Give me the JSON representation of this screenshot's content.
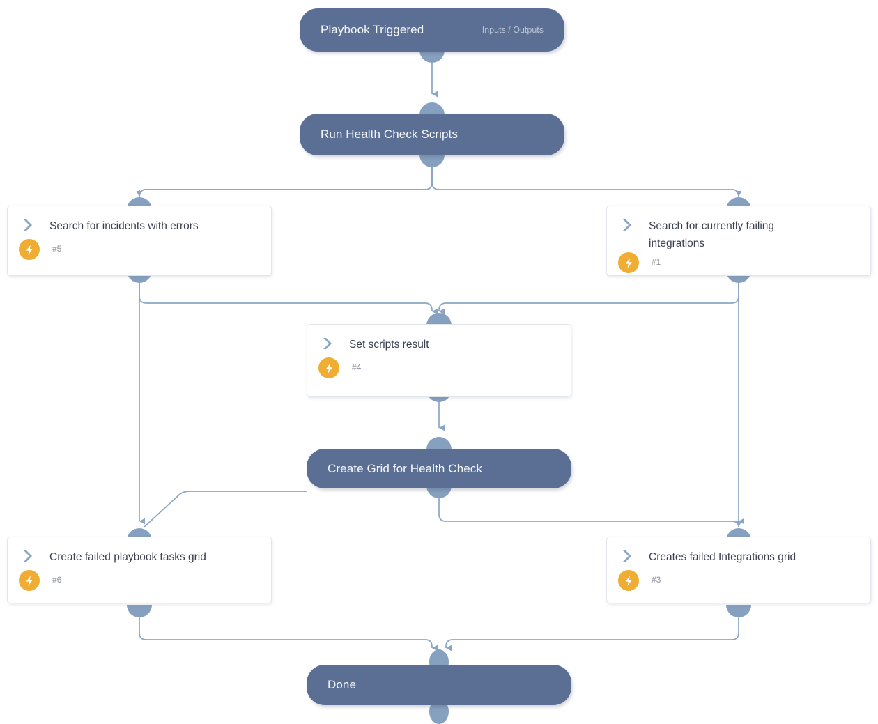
{
  "diagram": {
    "type": "playbook-workflow",
    "accent_color": "#5b6e94",
    "edge_color": "#8ba6c4",
    "badge_color": "#f0ad33",
    "card_background": "#ffffff",
    "canvas_background": "#ffffff"
  },
  "nodes": {
    "start": {
      "label": "Playbook Triggered",
      "meta": "Inputs / Outputs",
      "kind": "pill"
    },
    "run_health_check": {
      "label": "Run Health Check Scripts",
      "kind": "pill"
    },
    "search_incidents": {
      "label": "Search for incidents with errors",
      "id": "#5",
      "icon": "chevron-right-icon",
      "badge": "lightning-bolt-icon",
      "kind": "task"
    },
    "search_integrations": {
      "label": "Search for currently failing integrations",
      "id": "#1",
      "icon": "chevron-right-icon",
      "badge": "lightning-bolt-icon",
      "kind": "task"
    },
    "set_scripts_result": {
      "label": "Set scripts result",
      "id": "#4",
      "icon": "chevron-right-icon",
      "badge": "lightning-bolt-icon",
      "kind": "task"
    },
    "create_grid": {
      "label": "Create Grid for Health Check",
      "kind": "pill"
    },
    "failed_tasks_grid": {
      "label": "Create failed playbook tasks grid",
      "id": "#6",
      "icon": "chevron-right-icon",
      "badge": "lightning-bolt-icon",
      "kind": "task"
    },
    "failed_integrations_grid": {
      "label": "Creates failed Integrations grid",
      "id": "#3",
      "icon": "chevron-right-icon",
      "badge": "lightning-bolt-icon",
      "kind": "task"
    },
    "done": {
      "label": "Done",
      "kind": "pill"
    }
  },
  "edges": [
    {
      "from": "start",
      "to": "run_health_check"
    },
    {
      "from": "run_health_check",
      "to": "search_incidents"
    },
    {
      "from": "run_health_check",
      "to": "search_integrations"
    },
    {
      "from": "search_incidents",
      "to": "set_scripts_result"
    },
    {
      "from": "search_integrations",
      "to": "set_scripts_result"
    },
    {
      "from": "search_incidents",
      "to": "failed_tasks_grid"
    },
    {
      "from": "search_integrations",
      "to": "failed_integrations_grid"
    },
    {
      "from": "set_scripts_result",
      "to": "create_grid"
    },
    {
      "from": "create_grid",
      "to": "failed_tasks_grid"
    },
    {
      "from": "create_grid",
      "to": "failed_integrations_grid"
    },
    {
      "from": "failed_tasks_grid",
      "to": "done"
    },
    {
      "from": "failed_integrations_grid",
      "to": "done"
    }
  ]
}
